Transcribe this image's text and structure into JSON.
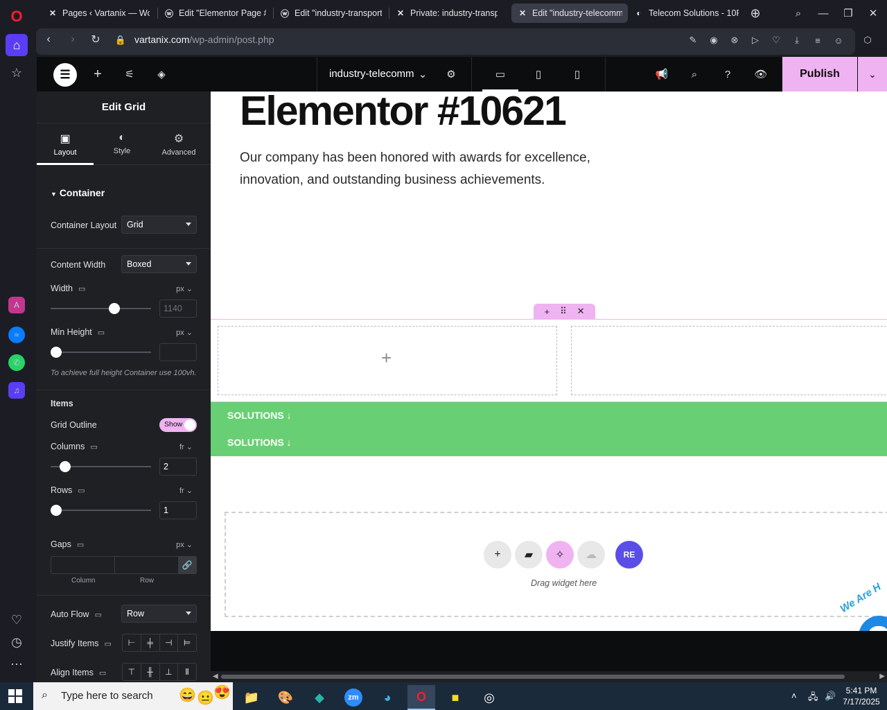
{
  "browser": {
    "tabs": [
      {
        "title": "Pages ‹ Vartanix — WordP",
        "icon": "elementor-x-icon",
        "active": false
      },
      {
        "title": "Edit \"Elementor Page #10",
        "icon": "wordpress-icon",
        "active": false
      },
      {
        "title": "Edit \"industry-transportat",
        "icon": "wordpress-icon",
        "active": false
      },
      {
        "title": "Private: industry-transpor",
        "icon": "elementor-x-icon",
        "active": false
      },
      {
        "title": "Edit \"industry-telecomm\"",
        "icon": "elementor-x-icon",
        "active": true
      },
      {
        "title": "Telecom Solutions - 10Pe",
        "icon": "tenpearls-icon",
        "active": false
      }
    ],
    "url_domain": "vartanix.com",
    "url_path": "/wp-admin/post.php"
  },
  "editor": {
    "page_name": "industry-telecomm",
    "publish_label": "Publish"
  },
  "panel": {
    "title": "Edit Grid",
    "tabs": [
      {
        "label": "Layout",
        "icon": "layout-icon",
        "active": true
      },
      {
        "label": "Style",
        "icon": "style-icon",
        "active": false
      },
      {
        "label": "Advanced",
        "icon": "gear-icon",
        "active": false
      }
    ],
    "section_title": "Container",
    "container_layout": {
      "label": "Container Layout",
      "value": "Grid"
    },
    "content_width": {
      "label": "Content Width",
      "value": "Boxed"
    },
    "width": {
      "label": "Width",
      "unit": "px",
      "placeholder": "1140",
      "slider_fraction": 0.58
    },
    "min_height": {
      "label": "Min Height",
      "unit": "px",
      "value": "",
      "slider_fraction": 0
    },
    "min_height_hint": "To achieve full height Container use 100vh.",
    "items_title": "Items",
    "grid_outline": {
      "label": "Grid Outline",
      "value": "Show"
    },
    "columns": {
      "label": "Columns",
      "unit": "fr",
      "value": "2",
      "slider_fraction": 0.09
    },
    "rows": {
      "label": "Rows",
      "unit": "fr",
      "value": "1",
      "slider_fraction": 0
    },
    "gaps": {
      "label": "Gaps",
      "unit": "px",
      "column_label": "Column",
      "row_label": "Row"
    },
    "auto_flow": {
      "label": "Auto Flow",
      "value": "Row"
    },
    "justify_items": {
      "label": "Justify Items"
    },
    "align_items": {
      "label": "Align Items"
    }
  },
  "canvas": {
    "heading": "Elementor #10621",
    "paragraph": "Our company has been honored with awards for excellence, innovation, and outstanding business achievements.",
    "solutions_1": "SOLUTIONS",
    "solutions_2": "SOLUTIONS",
    "drag_label": "Drag widget here",
    "chat_badge": "We Are H"
  },
  "taskbar": {
    "search_placeholder": "Type here to search",
    "time": "5:41 PM",
    "date": "7/17/2025"
  },
  "colors": {
    "accent": "#f0b3f2",
    "green_band": "#69cf74",
    "opera_active": "#5b3df5"
  }
}
